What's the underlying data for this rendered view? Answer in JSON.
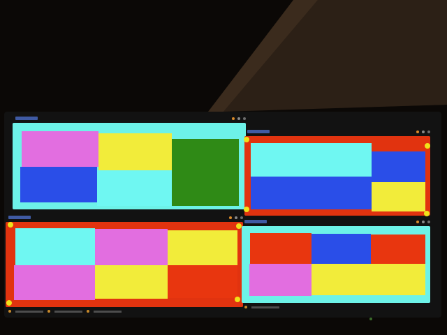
{
  "colors": {
    "magenta": "#e26ee0",
    "yellow": "#f2ec3a",
    "green": "#2f8a16",
    "blue": "#2a4ee8",
    "cyan": "#6ff7f2",
    "red": "#e8360f",
    "frame_cyan": "#6df2e8",
    "frame_red": "#e1330f",
    "handle_yellow": "#f0e21a"
  },
  "windows": [
    {
      "id": "top-left",
      "frame_color": "frame_cyan",
      "cells": [
        {
          "color": "magenta"
        },
        {
          "color": "yellow"
        },
        {
          "color": "green"
        },
        {
          "color": "blue"
        },
        {
          "color": "cyan"
        }
      ]
    },
    {
      "id": "top-right",
      "frame_color": "frame_red",
      "cells": [
        {
          "color": "cyan"
        },
        {
          "color": "blue"
        },
        {
          "color": "blue"
        },
        {
          "color": "yellow"
        }
      ]
    },
    {
      "id": "bottom-left",
      "frame_color": "frame_red",
      "cells": [
        {
          "color": "cyan"
        },
        {
          "color": "magenta"
        },
        {
          "color": "yellow"
        },
        {
          "color": "magenta"
        },
        {
          "color": "yellow"
        },
        {
          "color": "red"
        }
      ]
    },
    {
      "id": "bottom-right",
      "frame_color": "frame_cyan",
      "cells": [
        {
          "color": "red"
        },
        {
          "color": "blue"
        },
        {
          "color": "red"
        },
        {
          "color": "magenta"
        },
        {
          "color": "yellow"
        }
      ]
    }
  ]
}
